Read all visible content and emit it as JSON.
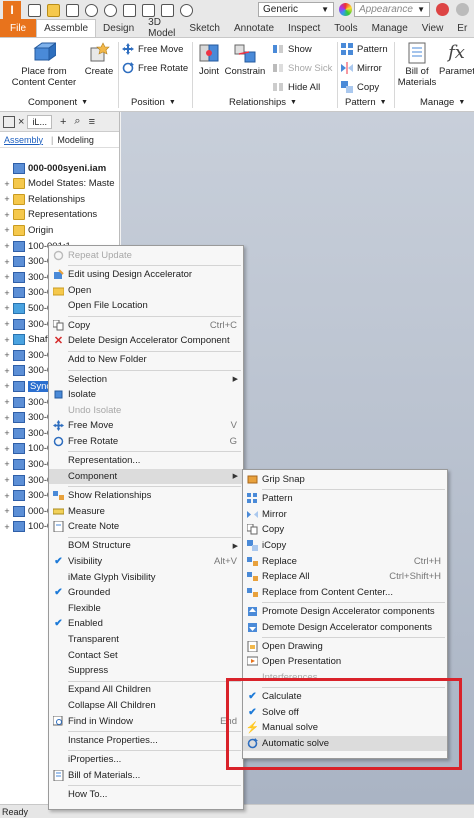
{
  "titlebar": {
    "logo": "I",
    "material": "Generic",
    "appearance": "Appearance"
  },
  "tabs": [
    "File",
    "Assemble",
    "Design",
    "3D Model",
    "Sketch",
    "Annotate",
    "Inspect",
    "Tools",
    "Manage",
    "View",
    "Er"
  ],
  "ribbon": {
    "place_label": "Place from\nContent Center",
    "create_label": "Create",
    "free_move": "Free Move",
    "free_rotate": "Free Rotate",
    "joint": "Joint",
    "constrain": "Constrain",
    "show": "Show",
    "show_sick": "Show Sick",
    "hide_all": "Hide All",
    "pattern": "Pattern",
    "mirror": "Mirror",
    "copy": "Copy",
    "bom": "Bill of\nMaterials",
    "param": "Paramete",
    "panels": {
      "component": "Component",
      "position": "Position",
      "relationships": "Relationships",
      "pattern": "Pattern",
      "manage": "Manage"
    }
  },
  "browser": {
    "tab_short": "iL...",
    "sub_assembly": "Assembly",
    "sub_modeling": "Modeling",
    "tree": [
      {
        "label": "000-000syeni.iam",
        "bold": true,
        "icon": "asm",
        "exp": ""
      },
      {
        "label": "Model States: Maste",
        "icon": "fold",
        "exp": "+"
      },
      {
        "label": "Relationships",
        "icon": "fold",
        "exp": "+"
      },
      {
        "label": "Representations",
        "icon": "fold",
        "exp": "+"
      },
      {
        "label": "Origin",
        "icon": "fold",
        "exp": "+"
      },
      {
        "label": "100-001:1",
        "icon": "asm",
        "exp": "+"
      },
      {
        "label": "300-0",
        "icon": "asm",
        "exp": "+"
      },
      {
        "label": "300-0",
        "icon": "asm",
        "exp": "+"
      },
      {
        "label": "300-0",
        "icon": "asm",
        "exp": "+"
      },
      {
        "label": "500-0",
        "icon": "prt",
        "exp": "+"
      },
      {
        "label": "300-0",
        "icon": "asm",
        "exp": "+"
      },
      {
        "label": "Shaft",
        "icon": "prt",
        "exp": "+"
      },
      {
        "label": "300-0",
        "icon": "asm",
        "exp": "+"
      },
      {
        "label": "300-0",
        "icon": "asm",
        "exp": "+"
      },
      {
        "label": "Sync",
        "icon": "asm",
        "exp": "+",
        "highlight": true
      },
      {
        "label": "300-0",
        "icon": "asm",
        "exp": "+"
      },
      {
        "label": "300-0",
        "icon": "asm",
        "exp": "+"
      },
      {
        "label": "300-0",
        "icon": "asm",
        "exp": "+"
      },
      {
        "label": "100-0",
        "icon": "asm",
        "exp": "+"
      },
      {
        "label": "300-0",
        "icon": "asm",
        "exp": "+"
      },
      {
        "label": "300-0",
        "icon": "asm",
        "exp": "+"
      },
      {
        "label": "300-0",
        "icon": "asm",
        "exp": "+"
      },
      {
        "label": "000-0",
        "icon": "asm",
        "exp": "+"
      },
      {
        "label": "100-0",
        "icon": "asm",
        "exp": "+"
      }
    ]
  },
  "status": "Ready",
  "menu": [
    {
      "label": "Repeat Update",
      "disabled": true,
      "icon": "repeat"
    },
    {
      "sep": true
    },
    {
      "label": "Edit using Design Accelerator",
      "icon": "edit"
    },
    {
      "label": "Open",
      "icon": "open"
    },
    {
      "label": "Open File Location"
    },
    {
      "sep": true
    },
    {
      "label": "Copy",
      "shortcut": "Ctrl+C",
      "icon": "copy"
    },
    {
      "label": "Delete Design Accelerator Component",
      "icon": "delete"
    },
    {
      "sep": true
    },
    {
      "label": "Add to New Folder"
    },
    {
      "sep": true
    },
    {
      "label": "Selection",
      "submenu": true
    },
    {
      "label": "Isolate",
      "icon": "isolate"
    },
    {
      "label": "Undo Isolate",
      "disabled": true
    },
    {
      "label": "Free Move",
      "shortcut": "V",
      "icon": "move"
    },
    {
      "label": "Free Rotate",
      "shortcut": "G",
      "icon": "rotate"
    },
    {
      "sep": true
    },
    {
      "label": "Representation..."
    },
    {
      "label": "Component",
      "submenu": true,
      "hover": true
    },
    {
      "sep": true
    },
    {
      "label": "Show Relationships",
      "icon": "rel"
    },
    {
      "label": "Measure",
      "icon": "measure"
    },
    {
      "label": "Create Note",
      "icon": "note"
    },
    {
      "sep": true
    },
    {
      "label": "BOM Structure",
      "submenu": true
    },
    {
      "label": "Visibility",
      "shortcut": "Alt+V",
      "check": true
    },
    {
      "label": "iMate Glyph Visibility"
    },
    {
      "label": "Grounded",
      "check": true
    },
    {
      "label": "Flexible"
    },
    {
      "label": "Enabled",
      "check": true
    },
    {
      "label": "Transparent"
    },
    {
      "label": "Contact Set"
    },
    {
      "label": "Suppress"
    },
    {
      "sep": true
    },
    {
      "label": "Expand All Children"
    },
    {
      "label": "Collapse All Children"
    },
    {
      "label": "Find in Window",
      "shortcut": "End",
      "icon": "find"
    },
    {
      "sep": true
    },
    {
      "label": "Instance Properties..."
    },
    {
      "sep": true
    },
    {
      "label": "iProperties..."
    },
    {
      "label": "Bill of Materials...",
      "icon": "bom"
    },
    {
      "sep": true
    },
    {
      "label": "How To..."
    }
  ],
  "submenu": [
    {
      "label": "Grip Snap",
      "icon": "grip"
    },
    {
      "sep": true
    },
    {
      "label": "Pattern",
      "icon": "pattern"
    },
    {
      "label": "Mirror",
      "icon": "mirror"
    },
    {
      "label": "Copy",
      "icon": "copy"
    },
    {
      "label": "iCopy",
      "icon": "icopy"
    },
    {
      "label": "Replace",
      "shortcut": "Ctrl+H",
      "icon": "replace"
    },
    {
      "label": "Replace All",
      "shortcut": "Ctrl+Shift+H",
      "icon": "replace"
    },
    {
      "label": "Replace from Content Center...",
      "icon": "replace"
    },
    {
      "sep": true
    },
    {
      "label": "Promote Design Accelerator components",
      "icon": "promote"
    },
    {
      "label": "Demote Design Accelerator components",
      "icon": "demote"
    },
    {
      "sep": true
    },
    {
      "label": "Open Drawing",
      "icon": "drawing"
    },
    {
      "label": "Open Presentation",
      "icon": "presentation"
    },
    {
      "label": "Interferences",
      "disabled": true,
      "icon": ""
    },
    {
      "sep": true
    },
    {
      "label": "Calculate",
      "check": true
    },
    {
      "label": "Solve off",
      "check": true
    },
    {
      "label": "Manual solve",
      "icon": "lightning"
    },
    {
      "label": "Automatic solve",
      "icon": "auto",
      "hover": true
    }
  ]
}
